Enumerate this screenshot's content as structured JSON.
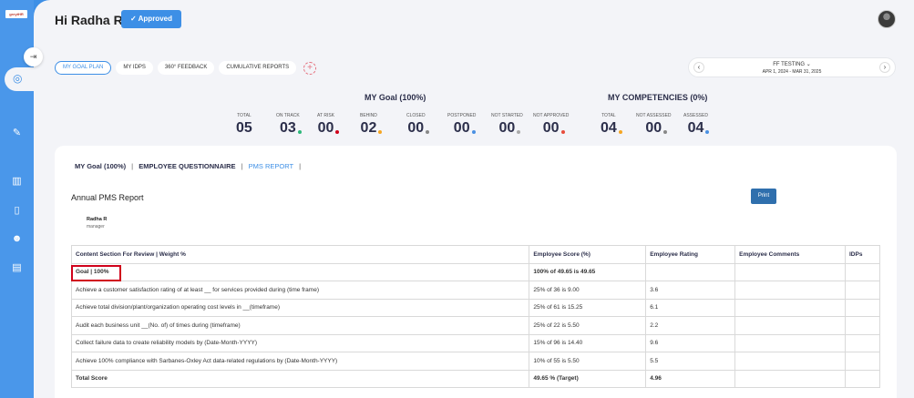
{
  "app": {
    "logo_text": "greytHR"
  },
  "header": {
    "greeting": "Hi Radha R",
    "status_badge": "Approved",
    "status_check": "✓"
  },
  "tabs": [
    {
      "label": "MY GOAL PLAN",
      "active": true
    },
    {
      "label": "MY IDPS"
    },
    {
      "label": "360° FEEDBACK"
    },
    {
      "label": "CUMULATIVE REPORTS"
    }
  ],
  "add_symbol": "+",
  "period": {
    "title": "FF TESTING",
    "range": "APR 1, 2024 - MAR 31, 2025",
    "prev": "‹",
    "next": "›",
    "chevron": "⌄"
  },
  "goal_summary": {
    "title": "MY Goal (100%)",
    "stats": [
      {
        "label": "TOTAL",
        "value": "05",
        "dot": ""
      },
      {
        "label": "ON TRACK",
        "value": "03",
        "dot": "#2eb87a"
      },
      {
        "label": "AT RISK",
        "value": "00",
        "dot": "#d0021b"
      },
      {
        "label": "BEHIND",
        "value": "02",
        "dot": "#f5a623"
      },
      {
        "label": "CLOSED",
        "value": "00",
        "dot": "#888888"
      },
      {
        "label": "POSTPONED",
        "value": "00",
        "dot": "#4a90e2"
      },
      {
        "label": "NOT STARTED",
        "value": "00",
        "dot": "#aaaaaa"
      },
      {
        "label": "NOT APPROVED",
        "value": "00",
        "dot": "#e74c3c"
      }
    ]
  },
  "competencies": {
    "title": "MY COMPETENCIES (0%)",
    "stats": [
      {
        "label": "TOTAL",
        "value": "04",
        "dot": "#f5a623"
      },
      {
        "label": "NOT ASSESSED",
        "value": "00",
        "dot": "#888888"
      },
      {
        "label": "ASSESSED",
        "value": "04",
        "dot": "#4a90e2"
      }
    ]
  },
  "subtabs": [
    {
      "label": "MY Goal (100%)"
    },
    {
      "label": "EMPLOYEE QUESTIONNAIRE"
    },
    {
      "label": "PMS REPORT",
      "active": true
    }
  ],
  "report": {
    "title": "Annual PMS Report",
    "print_label": "Print",
    "employee_name": "Radha R",
    "employee_role": "manager",
    "columns": [
      "Content Section For Review | Weight %",
      "Employee Score (%)",
      "Employee Rating",
      "Employee Comments",
      "IDPs"
    ],
    "goal_row": {
      "section": "Goal | 100%",
      "score": "100% of 49.65 is 49.65",
      "rating": "",
      "comments": "",
      "idps": ""
    },
    "rows": [
      {
        "section": "Achieve a customer satisfaction rating of at least __ for services provided during (time frame)",
        "score": "25% of 36 is 9.00",
        "rating": "3.6",
        "comments": "",
        "idps": ""
      },
      {
        "section": "Achieve total division/plant/organization operating cost levels in __(timeframe)",
        "score": "25% of 61 is 15.25",
        "rating": "6.1",
        "comments": "",
        "idps": ""
      },
      {
        "section": "Audit each business unit __(No. of) of times during (timeframe)",
        "score": "25% of 22 is 5.50",
        "rating": "2.2",
        "comments": "",
        "idps": ""
      },
      {
        "section": "Collect failure data to create reliability models by (Date-Month-YYYY)",
        "score": "15% of 96 is 14.40",
        "rating": "9.6",
        "comments": "",
        "idps": ""
      },
      {
        "section": "Achieve 100% compliance with Sarbanes-Oxley Act data-related regulations by (Date-Month-YYYY)",
        "score": "10% of 55 is 5.50",
        "rating": "5.5",
        "comments": "",
        "idps": ""
      }
    ],
    "total_row": {
      "section": "Total Score",
      "score": "49.65 % (Target)",
      "rating": "4.96",
      "comments": "",
      "idps": ""
    }
  }
}
